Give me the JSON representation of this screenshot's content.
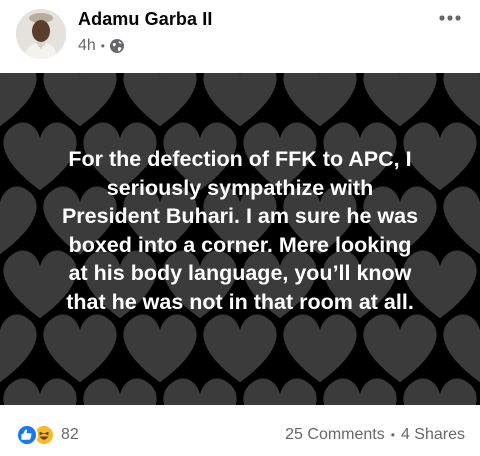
{
  "post": {
    "author": "Adamu Garba II",
    "time": "4h",
    "separator": "•",
    "audience_icon": "globe-icon",
    "more_icon": "more-dots-icon",
    "text": "For the defection of FFK to APC, I\nseriously sympathize with\nPresident Buhari. I am sure he was\nboxed into a corner. Mere looking\nat his body language, you’ll know\nthat he was not in that room at all.",
    "background": {
      "color": "#000000",
      "pattern": "hearts",
      "pattern_color": "#3b3b3b"
    }
  },
  "footer": {
    "reaction_icons": [
      "like-icon",
      "haha-icon"
    ],
    "reaction_count": "82",
    "comments": "25 Comments",
    "separator": "•",
    "shares": "4 Shares"
  },
  "colors": {
    "name": "#050505",
    "secondary": "#65676b",
    "like": "#1877f2",
    "haha": "#f7b928"
  }
}
